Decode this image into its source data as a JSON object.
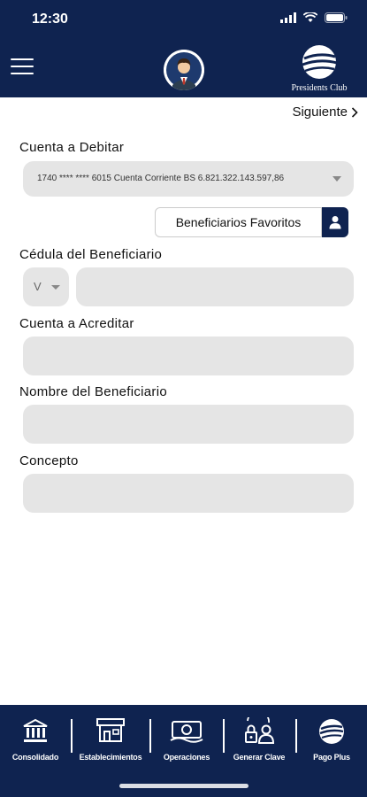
{
  "status": {
    "time": "12:30"
  },
  "header": {
    "brand": "Presidents Club"
  },
  "nav": {
    "next_label": "Siguiente"
  },
  "form": {
    "debit_label": "Cuenta a Debitar",
    "debit_value": "1740 **** **** 6015 Cuenta Corriente BS 6.821.322.143.597,86",
    "favorites_label": "Beneficiarios Favoritos",
    "id_label": "Cédula del Beneficiario",
    "id_type": "V",
    "id_value": "",
    "credit_label": "Cuenta a Acreditar",
    "credit_value": "",
    "name_label": "Nombre del Beneficiario",
    "name_value": "",
    "concept_label": "Concepto",
    "concept_value": ""
  },
  "tabs": [
    {
      "label": "Consolidado",
      "icon": "bank-icon"
    },
    {
      "label": "Establecimientos",
      "icon": "store-icon"
    },
    {
      "label": "Operaciones",
      "icon": "money-icon"
    },
    {
      "label": "Generar Clave",
      "icon": "lock-user-icon"
    },
    {
      "label": "Pago Plus",
      "icon": "pago-plus-icon"
    }
  ],
  "colors": {
    "primary": "#0f2350",
    "field_bg": "#e5e5e5"
  }
}
